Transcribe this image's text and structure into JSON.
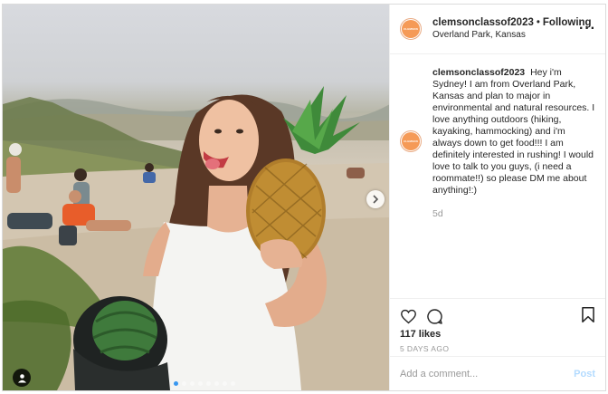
{
  "header": {
    "username": "clemsonclassof2023",
    "separator": "•",
    "follow_label": "Following",
    "location": "Overland Park, Kansas",
    "more_label": "···"
  },
  "caption": {
    "username": "clemsonclassof2023",
    "text": "Hey i'm Sydney! I am from Overland Park, Kansas and plan to major in environmental and natural resources. I love anything outdoors (hiking, kayaking, hammocking) and i'm always down to get food!!! I am definitely interested in rushing! I would love to talk to you guys, (i need a roommate!!) so please DM me about anything!:)",
    "age": "5d"
  },
  "stats": {
    "likes": "117 likes",
    "date": "5 DAYS AGO"
  },
  "comment_box": {
    "placeholder": "Add a comment...",
    "post_label": "Post"
  },
  "carousel": {
    "slide_count": 8,
    "active_index": 0
  },
  "icons": {
    "like": "heart-icon",
    "comment": "speech-bubble-icon",
    "save": "bookmark-icon",
    "next": "chevron-right-icon",
    "tag": "user-tag-icon",
    "more": "ellipsis-icon"
  },
  "colors": {
    "avatar_orange": "#f59a57",
    "post_button": "#b3dbff",
    "active_dot": "#3897f0",
    "muted_text": "#999999"
  }
}
